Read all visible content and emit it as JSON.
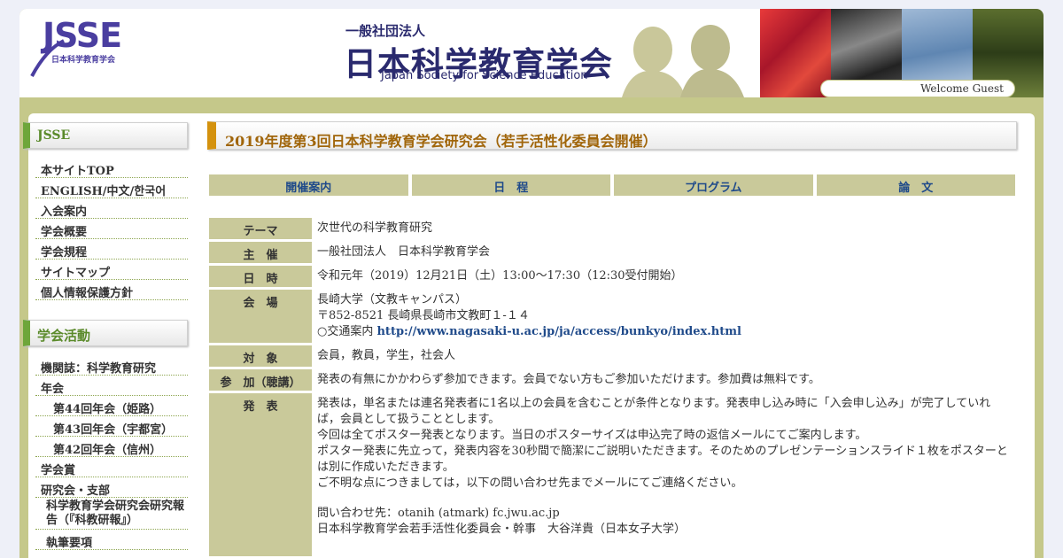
{
  "header": {
    "logo_text": "JSSE",
    "logo_sub": "日本科学教育学会",
    "org_small": "一般社団法人",
    "org_big": "日本科学教育学会",
    "org_en": "Japan Society for Science Education",
    "welcome": "Welcome Guest"
  },
  "sidebar": {
    "section1_title": "JSSE",
    "section1_items": [
      "本サイトTOP",
      "ENGLISH/中文/한국어",
      "入会案内",
      "学会概要",
      "学会規程",
      "サイトマップ",
      "個人情報保護方針"
    ],
    "section2_title": "学会活動",
    "section2_items": [
      "機関誌：科学教育研究",
      "年会",
      "第44回年会（姫路）",
      "第43回年会（宇都宮）",
      "第42回年会（信州）",
      "学会賞",
      "研究会・支部",
      "科学教育学会研究会研究報告（『科教研報』）",
      "執筆要項"
    ]
  },
  "main": {
    "title": "2019年度第3回日本科学教育学会研究会（若手活性化委員会開催）",
    "tabs": [
      "開催案内",
      "日　程",
      "プログラム",
      "論　文"
    ],
    "rows": {
      "theme_label": "テーマ",
      "theme_value": "次世代の科学教育研究",
      "host_label": "主　催",
      "host_value": "一般社団法人　日本科学教育学会",
      "date_label": "日　時",
      "date_value": "令和元年（2019）12月21日（土）13:00～17:30（12:30受付開始）",
      "venue_label": "会　場",
      "venue_line1": "長崎大学（文教キャンパス）",
      "venue_line2": "〒852-8521 長崎県長崎市文教町１-１４",
      "venue_line3": "○交通案内",
      "venue_link": "http://www.nagasaki-u.ac.jp/ja/access/bunkyo/index.html",
      "target_label": "対　象",
      "target_value": "会員，教員，学生，社会人",
      "join_label": "参　加（聴講）",
      "join_value": "発表の有無にかかわらず参加できます。会員でない方もご参加いただけます。参加費は無料です。",
      "present_label": "発　表",
      "present_line1": "発表は，単名または連名発表者に1名以上の会員を含むことが条件となります。発表申し込み時に「入会申し込み」が完了していれば，会員として扱うこととします。",
      "present_line2": "今回は全てポスター発表となります。当日のポスターサイズは申込完了時の返信メールにてご案内します。",
      "present_line3": "ポスター発表に先立って，発表内容を30秒間で簡潔にご説明いただきます。そのためのプレゼンテーションスライド１枚をポスターとは別に作成いただきます。",
      "present_line4": "ご不明な点につきましては，以下の問い合わせ先までメールにてご連絡ください。",
      "contact_line1": "問い合わせ先：otanih (atmark) fc.jwu.ac.jp",
      "contact_line2": "日本科学教育学会若手活性化委員会・幹事　大谷洋貴（日本女子大学）"
    }
  }
}
